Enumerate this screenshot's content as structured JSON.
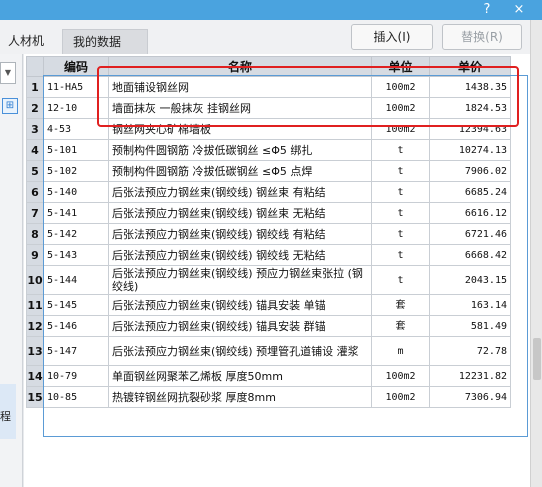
{
  "titlebar": {
    "help_icon": "?",
    "close_icon": "×"
  },
  "tabs": [
    {
      "label": "人材机"
    },
    {
      "label": "我的数据"
    }
  ],
  "buttons": {
    "insert": "插入(I)",
    "replace": "替换(R)"
  },
  "sidebar": {
    "text": "程"
  },
  "table": {
    "headers": {
      "code": "编码",
      "name": "名称",
      "unit": "单位",
      "price": "单价"
    },
    "rows": [
      {
        "num": "1",
        "code": "11-HA5",
        "name": "地面铺设钢丝网",
        "unit": "100m2",
        "price": "1438.35"
      },
      {
        "num": "2",
        "code": "12-10",
        "name": "墙面抹灰 一般抹灰 挂钢丝网",
        "unit": "100m2",
        "price": "1824.53"
      },
      {
        "num": "3",
        "code": "4-53",
        "name": "钢丝网夹心矿棉墙板",
        "unit": "100m2",
        "price": "12394.63"
      },
      {
        "num": "4",
        "code": "5-101",
        "name": "预制构件圆钢筋 冷拔低碳钢丝 ≤Φ5 绑扎",
        "unit": "t",
        "price": "10274.13"
      },
      {
        "num": "5",
        "code": "5-102",
        "name": "预制构件圆钢筋 冷拔低碳钢丝 ≤Φ5 点焊",
        "unit": "t",
        "price": "7906.02"
      },
      {
        "num": "6",
        "code": "5-140",
        "name": "后张法预应力钢丝束(钢绞线) 钢丝束 有粘结",
        "unit": "t",
        "price": "6685.24"
      },
      {
        "num": "7",
        "code": "5-141",
        "name": "后张法预应力钢丝束(钢绞线) 钢丝束 无粘结",
        "unit": "t",
        "price": "6616.12"
      },
      {
        "num": "8",
        "code": "5-142",
        "name": "后张法预应力钢丝束(钢绞线) 钢绞线 有粘结",
        "unit": "t",
        "price": "6721.46"
      },
      {
        "num": "9",
        "code": "5-143",
        "name": "后张法预应力钢丝束(钢绞线) 钢绞线 无粘结",
        "unit": "t",
        "price": "6668.42"
      },
      {
        "num": "10",
        "code": "5-144",
        "name": "后张法预应力钢丝束(钢绞线) 预应力钢丝束张拉 (钢绞线)",
        "unit": "t",
        "price": "2043.15"
      },
      {
        "num": "11",
        "code": "5-145",
        "name": "后张法预应力钢丝束(钢绞线) 锚具安装 单锚",
        "unit": "套",
        "price": "163.14"
      },
      {
        "num": "12",
        "code": "5-146",
        "name": "后张法预应力钢丝束(钢绞线) 锚具安装 群锚",
        "unit": "套",
        "price": "581.49"
      },
      {
        "num": "13",
        "code": "5-147",
        "name": "后张法预应力钢丝束(钢绞线) 预埋管孔道铺设 灌浆",
        "unit": "m",
        "price": "72.78"
      },
      {
        "num": "14",
        "code": "10-79",
        "name": "单面钢丝网聚苯乙烯板 厚度50mm",
        "unit": "100m2",
        "price": "12231.82"
      },
      {
        "num": "15",
        "code": "10-85",
        "name": "热镀锌钢丝网抗裂砂浆 厚度8mm",
        "unit": "100m2",
        "price": "7306.94"
      }
    ]
  },
  "colors": {
    "header_bg": "#d6dbe2",
    "titlebar": "#4aa3df",
    "highlight_box": "#e02020",
    "selection_border": "#5b9bd5"
  }
}
